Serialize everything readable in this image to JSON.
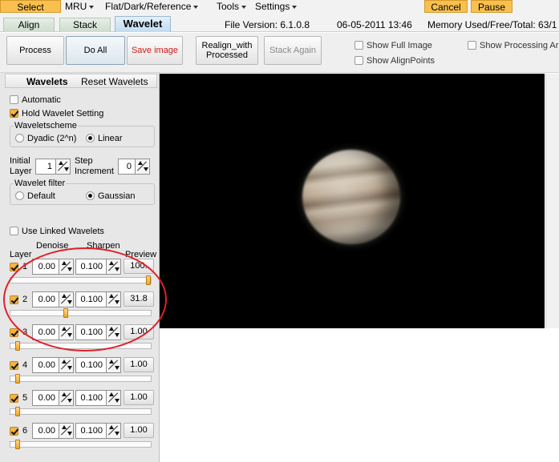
{
  "menubar": {
    "select": "Select",
    "mru": "MRU",
    "flat_dark_reference": "Flat/Dark/Reference",
    "tools": "Tools",
    "settings": "Settings",
    "cancel": "Cancel",
    "pause": "Pause"
  },
  "tabs": {
    "align": "Align",
    "stack": "Stack",
    "wavelet": "Wavelet"
  },
  "info": {
    "file_version": "File Version: 6.1.0.8",
    "date_time": "06-05-2011 13:46",
    "memory": "Memory Used/Free/Total: 63/1"
  },
  "toolbar": {
    "process": "Process",
    "do_all": "Do All",
    "save_image": "Save image",
    "realign_line1": "Realign_with",
    "realign_line2": "Processed",
    "stack_again": "Stack Again",
    "show_full_image": "Show Full Image",
    "show_alignpoints": "Show AlignPoints",
    "show_processing_area": "Show Processing Ar"
  },
  "panel": {
    "wavelets_tab": "Wavelets",
    "reset_wavelets": "Reset Wavelets",
    "automatic": "Automatic",
    "hold_wavelet_setting": "Hold Wavelet Setting",
    "waveletscheme_label": "Waveletscheme",
    "dyadic": "Dyadic (2^n)",
    "linear": "Linear",
    "initial_line1": "Initial",
    "initial_line2": "Layer",
    "initial_value": "1",
    "step_line1": "Step",
    "step_line2": "Increment",
    "step_value": "0",
    "filter_label": "Wavelet filter",
    "default": "Default",
    "gaussian": "Gaussian",
    "use_linked_wavelets": "Use Linked Wavelets",
    "col_layer": "Layer",
    "col_denoise": "Denoise",
    "col_sharpen": "Sharpen",
    "col_preview": "Preview"
  },
  "layers": [
    {
      "num": "1",
      "denoise": "0.00",
      "sharpen": "0.100",
      "preview": "100.",
      "checked": true,
      "slider_level": 1.0
    },
    {
      "num": "2",
      "denoise": "0.00",
      "sharpen": "0.100",
      "preview": "31.8",
      "checked": true,
      "slider_level": 0.37
    },
    {
      "num": "3",
      "denoise": "0.00",
      "sharpen": "0.100",
      "preview": "1.00",
      "checked": true,
      "slider_level": 0.0
    },
    {
      "num": "4",
      "denoise": "0.00",
      "sharpen": "0.100",
      "preview": "1.00",
      "checked": true,
      "slider_level": 0.0
    },
    {
      "num": "5",
      "denoise": "0.00",
      "sharpen": "0.100",
      "preview": "1.00",
      "checked": true,
      "slider_level": 0.0
    },
    {
      "num": "6",
      "denoise": "0.00",
      "sharpen": "0.100",
      "preview": "1.00",
      "checked": true,
      "slider_level": 0.0
    }
  ],
  "colors": {
    "accent_orange": "#f9c04f",
    "save_red": "#d01818",
    "annotation_red": "#e0202a"
  }
}
